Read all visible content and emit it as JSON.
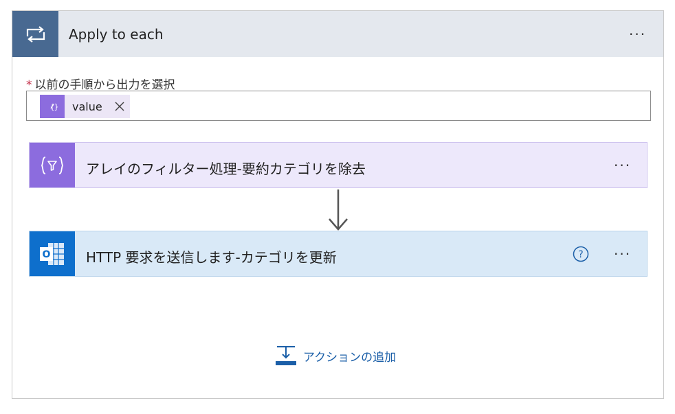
{
  "scope": {
    "title": "Apply to each",
    "icon": "loop-icon",
    "menu_label": "···",
    "header_color": "#e4e8ee",
    "icon_bg": "#486991"
  },
  "input_field": {
    "label": "以前の手順から出力を選択",
    "required_marker": "*",
    "token": {
      "label": "value",
      "icon": "expression-icon",
      "color": "#8c6cde"
    }
  },
  "actions": [
    {
      "title": "アレイのフィルター処理-要約カテゴリを除去",
      "icon": "filter-array-icon",
      "menu_label": "···",
      "color": "#8c6cde"
    },
    {
      "title": "HTTP 要求を送信します-カテゴリを更新",
      "icon": "outlook-icon",
      "menu_label": "···",
      "color": "#0e6fcc"
    }
  ],
  "add_action": {
    "label": "アクションの追加",
    "color": "#1b5fa8"
  }
}
